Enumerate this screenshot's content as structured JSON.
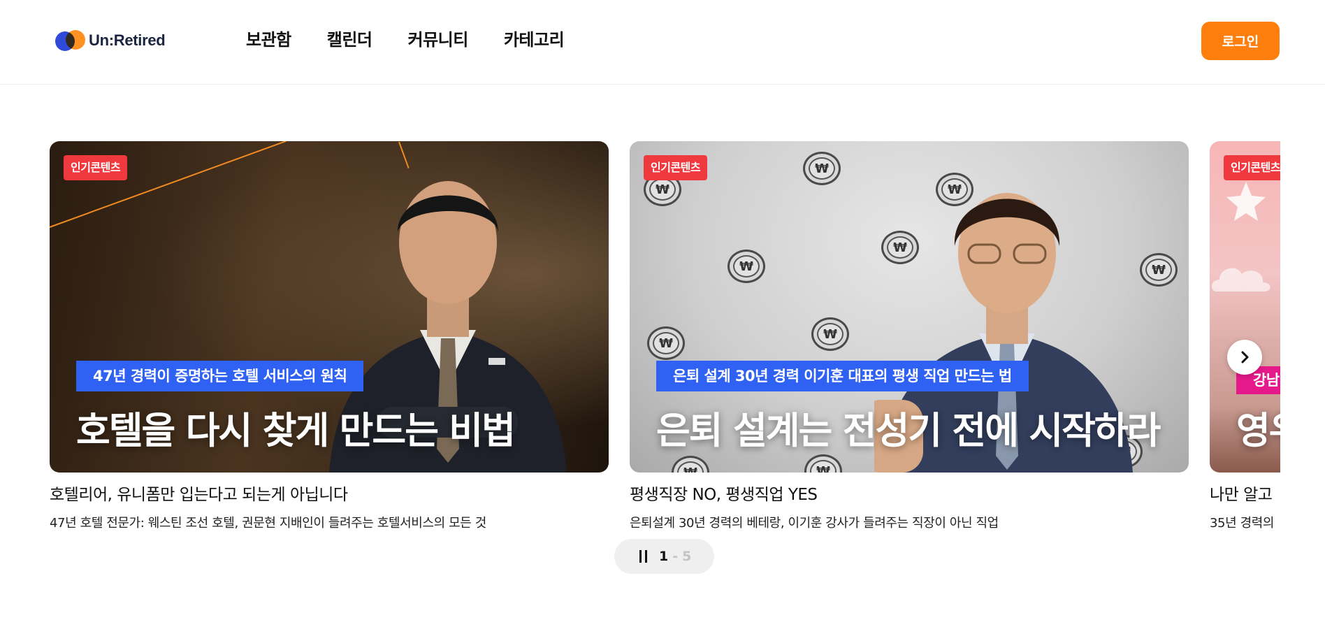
{
  "header": {
    "logo_text": "Un:Retired",
    "nav": [
      {
        "label": "보관함"
      },
      {
        "label": "캘린더"
      },
      {
        "label": "커뮤니티"
      },
      {
        "label": "카테고리"
      }
    ],
    "login_label": "로그인"
  },
  "carousel": {
    "cards": [
      {
        "badge": "인기콘텐츠",
        "subtitle": "47년 경력이 증명하는 호텔 서비스의 원칙",
        "headline": "호텔을 다시 찾게 만드는 비법",
        "title": "호텔리어, 유니폼만 입는다고 되는게 아닙니다",
        "description": "47년 호텔 전문가: 웨스틴 조선 호텔, 권문현 지배인이 들려주는 호텔서비스의 모든 것"
      },
      {
        "badge": "인기콘텐츠",
        "subtitle": "은퇴 설계 30년 경력 이기훈 대표의 평생 직업 만드는 법",
        "headline": "은퇴 설계는 전성기 전에 시작하라",
        "title": "평생직장 NO, 평생직업 YES",
        "description": "은퇴설계 30년 경력의 베테랑, 이기훈 강사가 들려주는 직장이 아닌 직업",
        "coin_symbol": "₩"
      },
      {
        "badge": "인기콘텐츠",
        "subtitle": "강남",
        "headline": "영우",
        "title": "나만 알고",
        "description": "35년 경력의"
      }
    ],
    "pager": {
      "current": "1",
      "separator": "-",
      "total": "5"
    }
  },
  "colors": {
    "accent": "#ff7f0e",
    "badge": "#f0393f",
    "subtitle_blue": "#2f62f3",
    "subtitle_pink": "#e6198a",
    "logo_blue": "#2f49d8",
    "logo_orange": "#ff8a16"
  }
}
